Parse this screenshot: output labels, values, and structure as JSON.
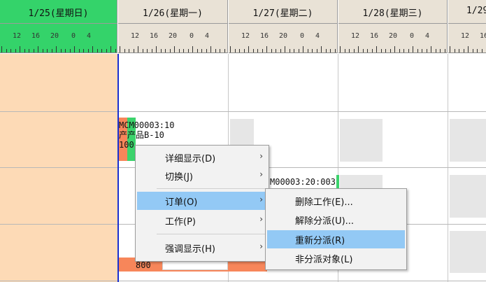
{
  "timeline": {
    "days": [
      {
        "date": "1/25(星期日)",
        "active": true
      },
      {
        "date": "1/26(星期一)",
        "active": false
      },
      {
        "date": "1/27(星期二)",
        "active": false
      },
      {
        "date": "1/28(星期三)",
        "active": false
      },
      {
        "date": "1/29",
        "active": false
      }
    ],
    "hour_labels": [
      "12",
      "16",
      "20",
      "0",
      "4"
    ]
  },
  "tasks": {
    "task1_line1": "MCM00003:10",
    "task1_line2": "产产品B-10",
    "task1_line3": "100",
    "task2_label": "M00003:20:003",
    "task3_label": "800"
  },
  "context_menu": {
    "items": [
      {
        "label": "详细显示(D)",
        "has_submenu": true
      },
      {
        "label": "切换(J)",
        "has_submenu": true
      },
      {
        "label": "订单(O)",
        "has_submenu": true,
        "highlighted": true
      },
      {
        "label": "工作(P)",
        "has_submenu": true
      },
      {
        "label": "强调显示(H)",
        "has_submenu": true
      }
    ],
    "arrow_glyph": "›"
  },
  "submenu": {
    "items": [
      {
        "label": "删除工作(E)..."
      },
      {
        "label": "解除分派(U)..."
      },
      {
        "label": "重新分派(R)",
        "highlighted": true
      },
      {
        "label": "非分派对象(L)"
      }
    ]
  },
  "colors": {
    "active_header": "#34d36a",
    "header": "#e9e2d6",
    "left_band": "#fddab6",
    "now_line": "#1a2fd0",
    "highlight": "#93c9f5",
    "task_orange": "#f7865a",
    "task_green": "#3cd36c"
  }
}
